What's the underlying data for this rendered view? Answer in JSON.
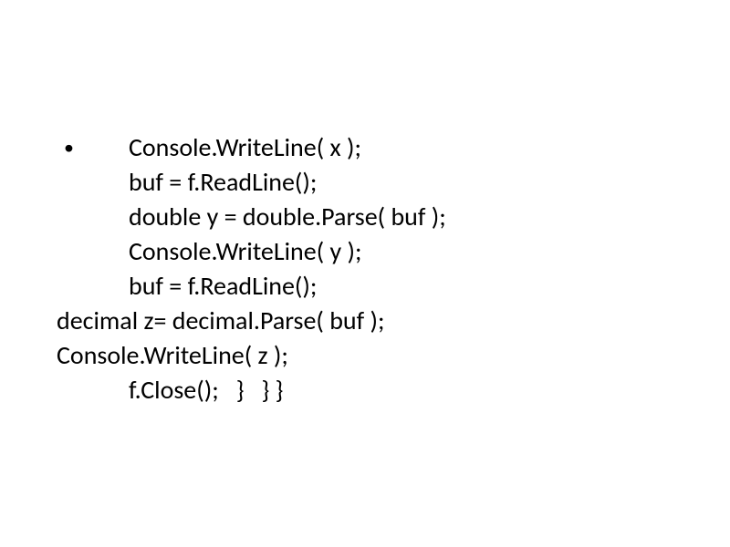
{
  "code": {
    "line1": "   Console.WriteLine( x );",
    "line2": "   buf = f.ReadLine();",
    "line3": "   double y = double.Parse( buf );",
    "line4": "   Console.WriteLine( y );",
    "line5": "   buf = f.ReadLine();",
    "line6": "decimal z= decimal.Parse( buf );",
    "line7": "Console.WriteLine( z );",
    "line8": "   f.Close();   }   } }"
  },
  "bullet": "•"
}
